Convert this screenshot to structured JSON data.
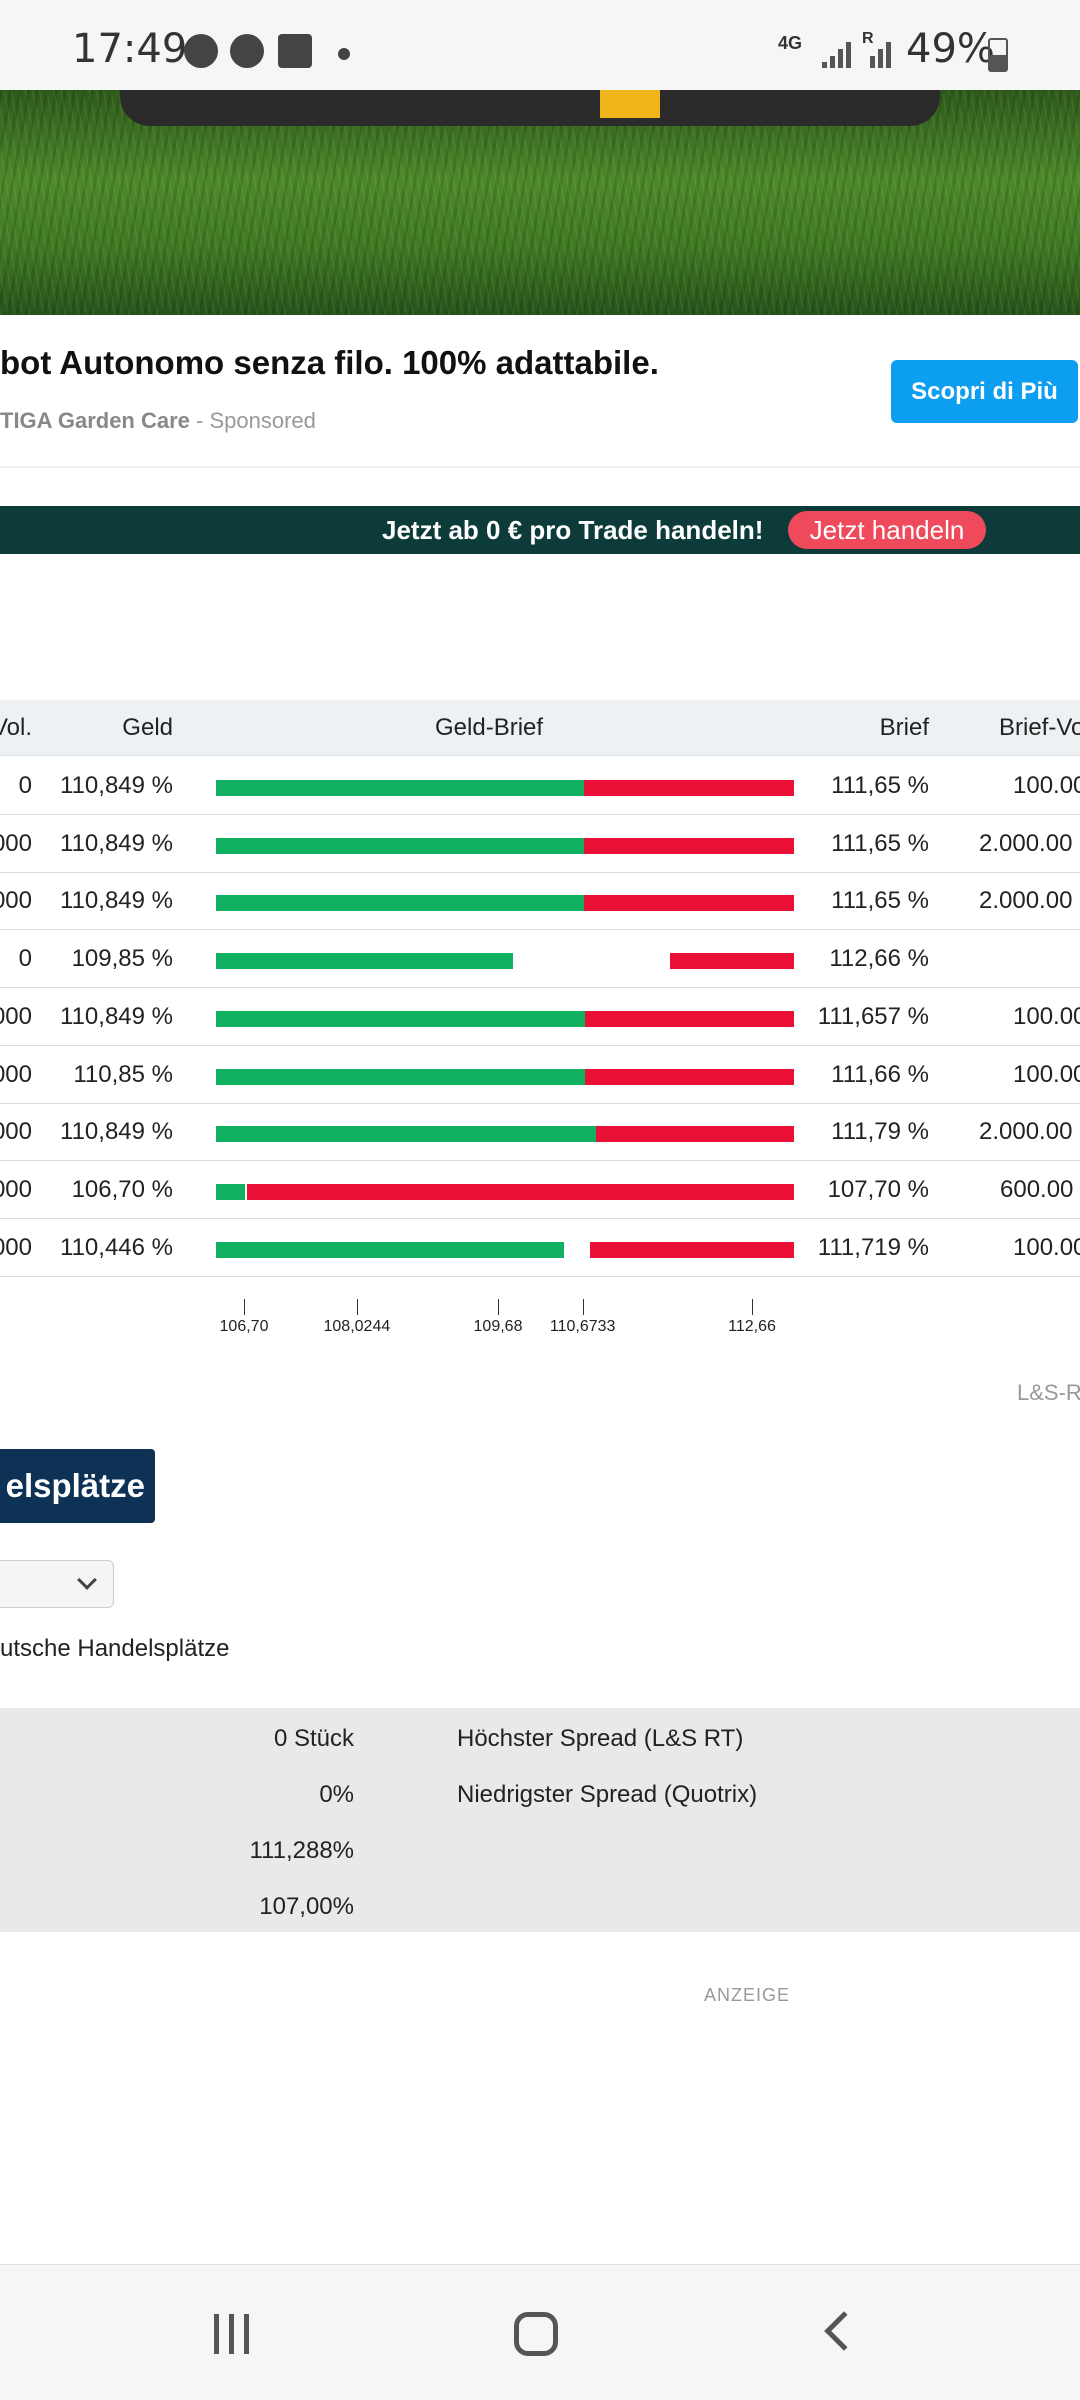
{
  "status_bar": {
    "time": "17:49",
    "network": "4G",
    "roaming": "R",
    "battery": "49%"
  },
  "ad": {
    "title": "bot Autonomo senza filo. 100% adattabile.",
    "brand": "TIGA Garden Care",
    "sponsored": " - Sponsored",
    "cta": "Scopri di Più"
  },
  "trade_banner": {
    "text": "Jetzt ab 0 € pro Trade handeln!",
    "button": "Jetzt handeln"
  },
  "table": {
    "headers": {
      "vol": "Vol.",
      "geld": "Geld",
      "geld_brief": "Geld-Brief",
      "brief": "Brief",
      "brief_vol": "Brief-Vo"
    },
    "rows": [
      {
        "vol": "0",
        "geld": "110,849 %",
        "brief": "111,65 %",
        "brief_vol": "100.00"
      },
      {
        "vol": "000",
        "geld": "110,849 %",
        "brief": "111,65 %",
        "brief_vol": "2.000.00"
      },
      {
        "vol": "000",
        "geld": "110,849 %",
        "brief": "111,65 %",
        "brief_vol": "2.000.00"
      },
      {
        "vol": "0",
        "geld": "109,85 %",
        "brief": "112,66 %",
        "brief_vol": ""
      },
      {
        "vol": "000",
        "geld": "110,849 %",
        "brief": "111,657 %",
        "brief_vol": "100.00"
      },
      {
        "vol": "000",
        "geld": "110,85 %",
        "brief": "111,66 %",
        "brief_vol": "100.00"
      },
      {
        "vol": "000",
        "geld": "110,849 %",
        "brief": "111,79 %",
        "brief_vol": "2.000.00"
      },
      {
        "vol": "000",
        "geld": "106,70 %",
        "brief": "107,70 %",
        "brief_vol": "600.00"
      },
      {
        "vol": "000",
        "geld": "110,446 %",
        "brief": "111,719 %",
        "brief_vol": "100.00"
      }
    ],
    "axis_ticks": [
      "106,70",
      "108,0244",
      "109,68",
      "110,6733",
      "112,66"
    ],
    "source_note": "L&S-R"
  },
  "chart_data": {
    "type": "bar",
    "categories": [
      "1",
      "2",
      "3",
      "4",
      "5",
      "6",
      "7",
      "8",
      "9"
    ],
    "series": [
      {
        "name": "Geld",
        "values": [
          110.849,
          110.849,
          110.849,
          109.85,
          110.849,
          110.85,
          110.849,
          106.7,
          110.446
        ]
      },
      {
        "name": "Brief",
        "values": [
          111.65,
          111.65,
          111.65,
          112.66,
          111.657,
          111.66,
          111.79,
          107.7,
          111.719
        ]
      }
    ],
    "xlim": [
      106.7,
      112.66
    ],
    "tick_values": [
      106.7,
      108.0244,
      109.68,
      110.6733,
      112.66
    ],
    "colors": {
      "geld": "#0fb161",
      "brief": "#ea0f35"
    }
  },
  "handelsplaetze": {
    "heading": "elsplätze",
    "subtitle": "utsche Handelsplätze"
  },
  "stats": {
    "values": [
      "0 Stück",
      "0%",
      "111,288%",
      "107,00%"
    ],
    "labels": [
      "Höchster Spread (L&S RT)",
      "Niedrigster Spread (Quotrix)"
    ]
  },
  "anzeige": "ANZEIGE"
}
